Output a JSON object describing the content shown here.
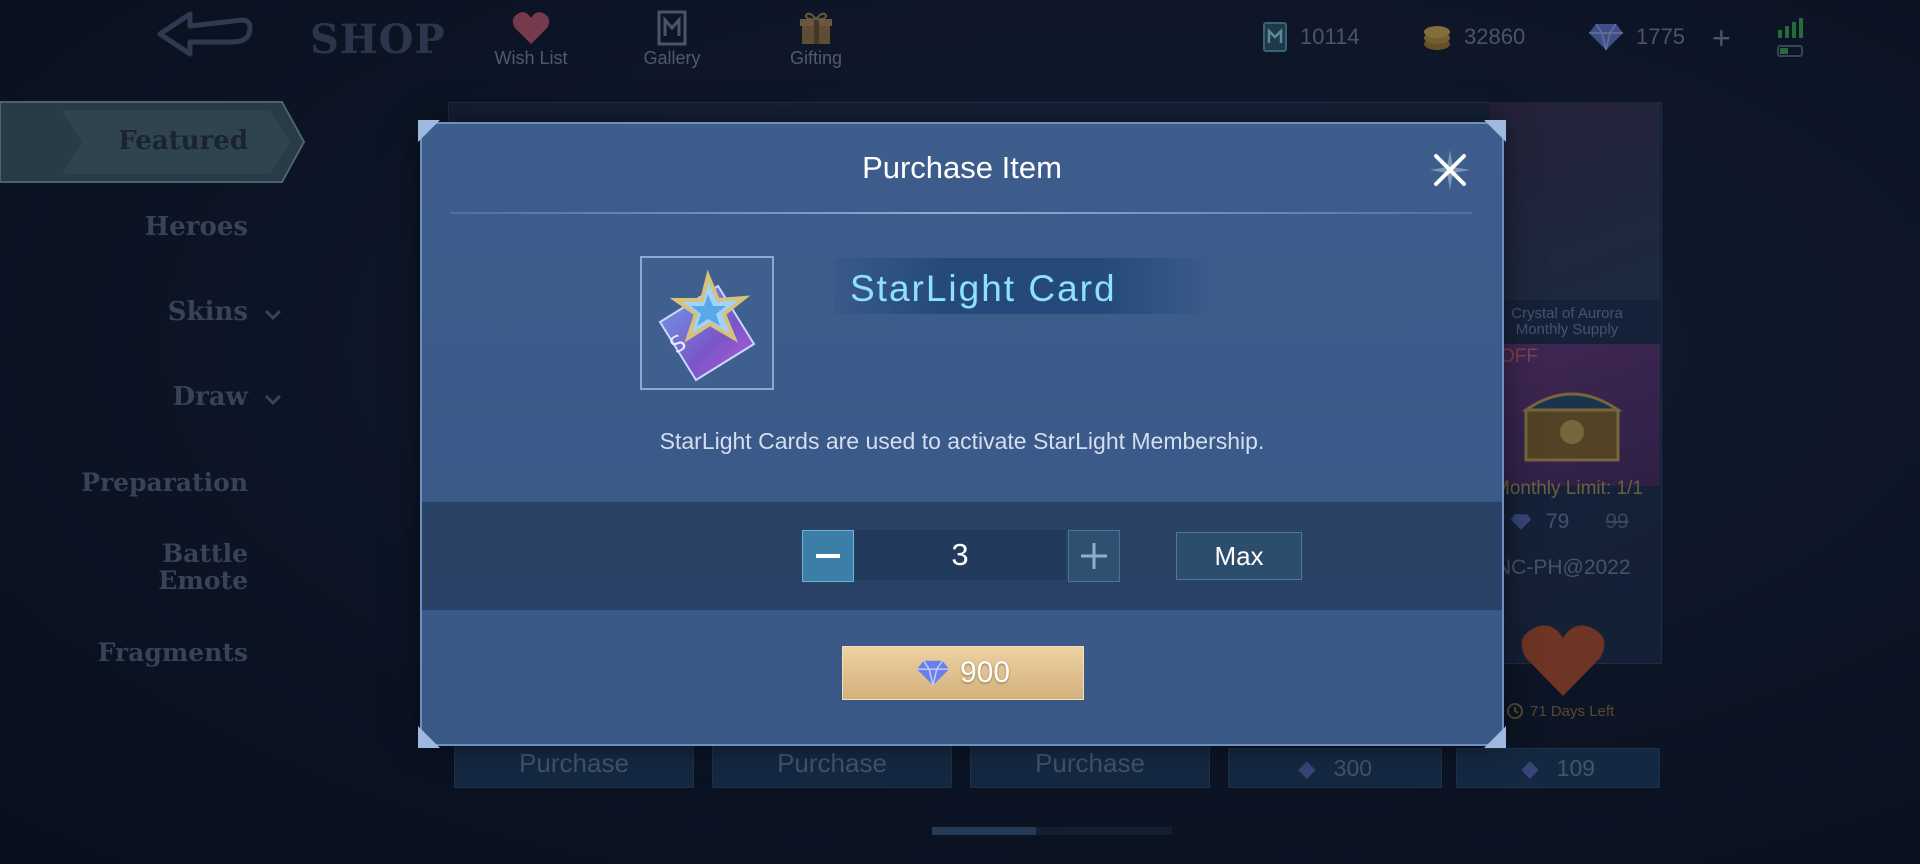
{
  "header": {
    "shop_title": "SHOP",
    "nav": [
      {
        "label": "Wish List",
        "icon": "heart-icon"
      },
      {
        "label": "Gallery",
        "icon": "gallery-icon"
      },
      {
        "label": "Gifting",
        "icon": "gift-icon"
      }
    ],
    "currencies": [
      {
        "icon": "ticket-icon",
        "value": "10114"
      },
      {
        "icon": "battle-points-icon",
        "value": "32860"
      },
      {
        "icon": "diamond-icon",
        "value": "1775"
      }
    ]
  },
  "sidebar": {
    "items": [
      {
        "label": "Featured"
      },
      {
        "label": "Heroes"
      },
      {
        "label": "Skins"
      },
      {
        "label": "Draw"
      },
      {
        "label": "Preparation"
      },
      {
        "label": "Battle Emote"
      },
      {
        "label": "Fragments"
      }
    ]
  },
  "background": {
    "card_title": "Crystal of Aurora Monthly Supply",
    "off_badge": "OFF",
    "monthly_limit": "Monthly Limit: 1/1",
    "price_now": "79",
    "price_old": "99",
    "event_code": "NC-PH@2022",
    "days_left": "71 Days Left",
    "purchase_label": "Purchase",
    "bottom_prices": [
      "300",
      "109"
    ]
  },
  "dialog": {
    "title": "Purchase Item",
    "item_name": "StarLight Card",
    "description": "StarLight Cards are used to activate StarLight Membership.",
    "quantity": "3",
    "max_label": "Max",
    "price": "900"
  },
  "colors": {
    "dialog_bg": "#3d5d8c",
    "item_name": "#8fe0ff",
    "price_button": "#d4b07c"
  }
}
